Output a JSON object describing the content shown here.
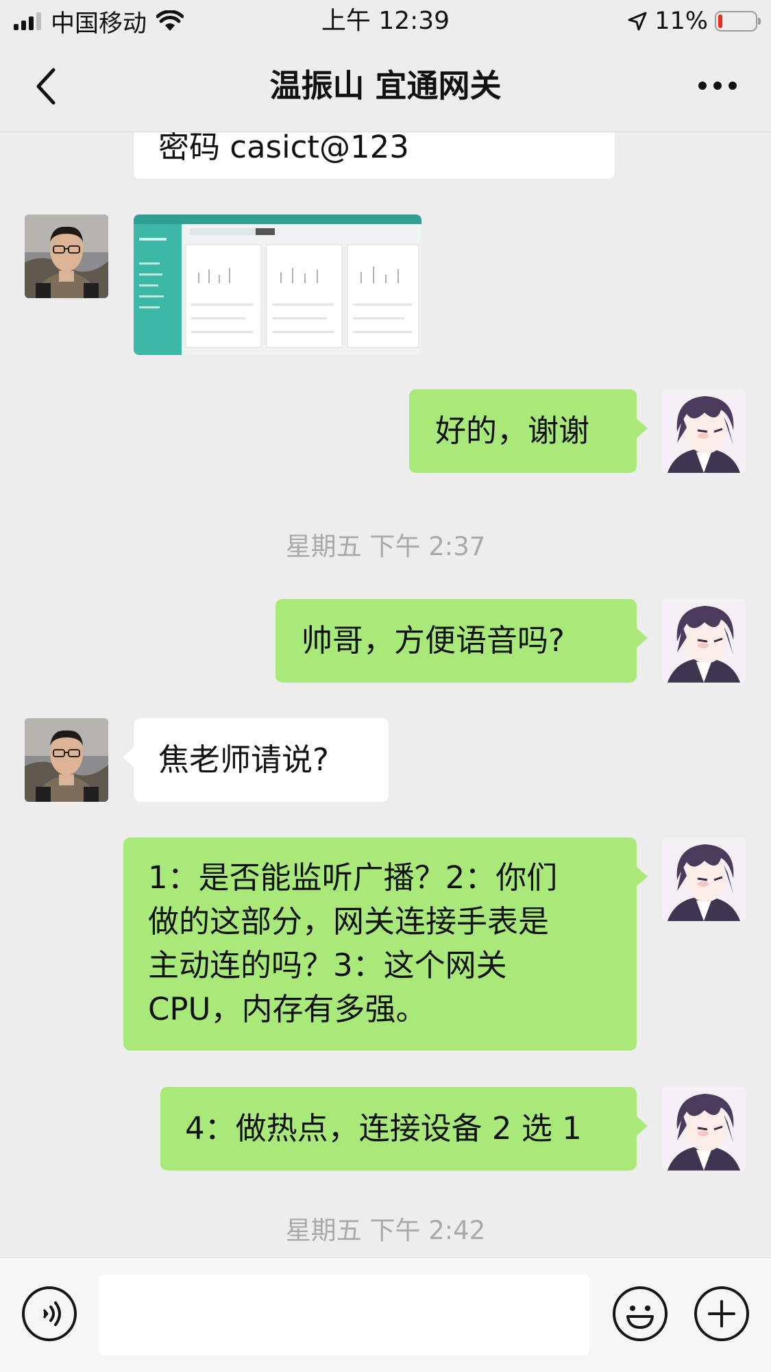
{
  "status_bar": {
    "carrier": "中国移动",
    "time": "上午 12:39",
    "battery_percent": "11%",
    "battery_level": 0.11
  },
  "nav": {
    "title": "温振山 宜通网关"
  },
  "messages": {
    "m0": "密码 casict@123",
    "m2": "好的，谢谢",
    "t1": "星期五 下午 2:37",
    "m3": "帅哥，方便语音吗?",
    "m4": "焦老师请说?",
    "m5_lines": [
      "1：是否能监听广播？2：你们",
      "做的这部分，网关连接手表是",
      "主动连的吗？3：这个网关",
      "CPU，内存有多强。"
    ],
    "m6": "4：做热点，连接设备 2 选 1",
    "t2": "星期五 下午 2:42"
  },
  "input": {
    "placeholder": ""
  },
  "colors": {
    "background": "#ededed",
    "bubble_green": "#a9e97a",
    "bubble_white": "#ffffff",
    "battery_low": "#f0281e"
  }
}
